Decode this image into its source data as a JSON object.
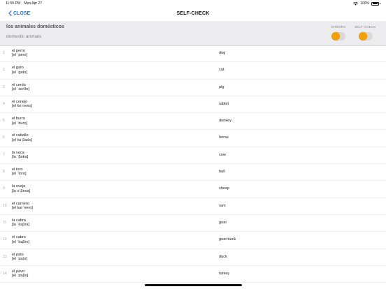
{
  "status_bar": {
    "time": "11:55 PM",
    "date": "Mon Apr 27",
    "battery": "100%"
  },
  "nav": {
    "back_label": "CLOSE",
    "title": "SELF-CHECK"
  },
  "lesson": {
    "title": "los animales domésticos",
    "subtitle": "domestic animals"
  },
  "toggles": {
    "errors_label": "ERRORS",
    "errors_on": false,
    "selfcheck_label": "SELF-CHECK",
    "selfcheck_on": false,
    "knob_color": "#f4a000"
  },
  "rows": [
    {
      "num": "1",
      "word": "el perro",
      "ipa": "[el ˈpero]",
      "translation": "dog"
    },
    {
      "num": "2",
      "word": "el gato",
      "ipa": "[el ˈgato]",
      "translation": "cat"
    },
    {
      "num": "3",
      "word": "el cerdo",
      "ipa": "[el ˈserðo]",
      "translation": "pig"
    },
    {
      "num": "4",
      "word": "el conejo",
      "ipa": "[el koˈnexo]",
      "translation": "rabbit"
    },
    {
      "num": "5",
      "word": "el burro",
      "ipa": "[el ˈburo]",
      "translation": "donkey"
    },
    {
      "num": "6",
      "word": "el caballo",
      "ipa": "[el kaˈβaʎo]",
      "translation": "horse"
    },
    {
      "num": "7",
      "word": "la vaca",
      "ipa": "[la ˈβaka]",
      "translation": "cow"
    },
    {
      "num": "8",
      "word": "el toro",
      "ipa": "[el ˈtoro]",
      "translation": "bull"
    },
    {
      "num": "9",
      "word": "la oveja",
      "ipa": "[la oˈβexa]",
      "translation": "sheep"
    },
    {
      "num": "10",
      "word": "el carnero",
      "ipa": "[el karˈnero]",
      "translation": "ram"
    },
    {
      "num": "11",
      "word": "la cabra",
      "ipa": "[la ˈkaβra]",
      "translation": "goat"
    },
    {
      "num": "12",
      "word": "el cabro",
      "ipa": "[el ˈkaβro]",
      "translation": "goat buck"
    },
    {
      "num": "13",
      "word": "el pato",
      "ipa": "[el ˈpato]",
      "translation": "duck"
    },
    {
      "num": "14",
      "word": "el pavo",
      "ipa": "[el ˈpaβo]",
      "translation": "turkey"
    }
  ]
}
